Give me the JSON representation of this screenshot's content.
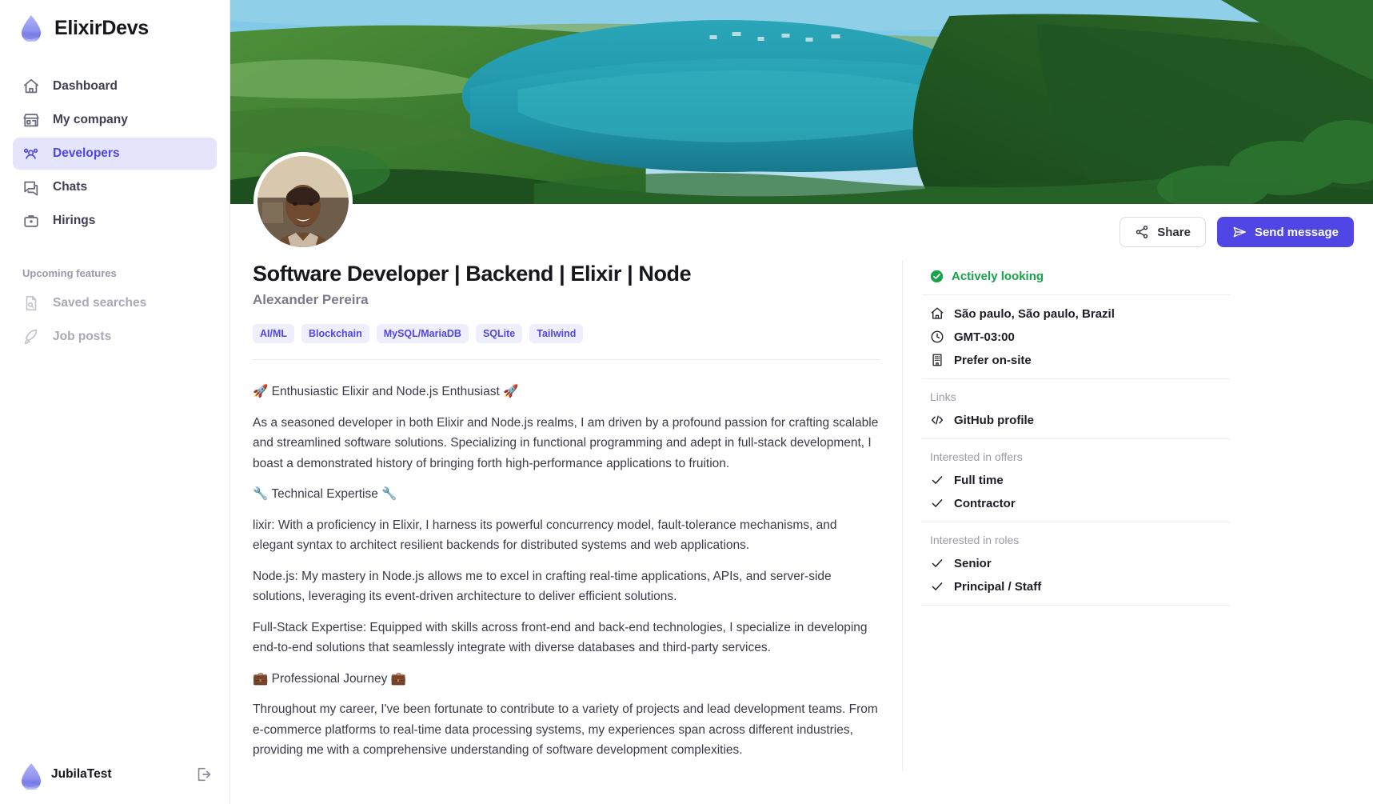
{
  "brand": {
    "name": "ElixirDevs",
    "logo_icon": "water-drop-icon"
  },
  "sidebar": {
    "items": [
      {
        "label": "Dashboard",
        "icon": "home-icon"
      },
      {
        "label": "My company",
        "icon": "store-icon"
      },
      {
        "label": "Developers",
        "icon": "users-group-icon"
      },
      {
        "label": "Chats",
        "icon": "chat-bubble-icon"
      },
      {
        "label": "Hirings",
        "icon": "briefcase-icon"
      }
    ],
    "section_label": "Upcoming features",
    "upcoming": [
      {
        "label": "Saved searches",
        "icon": "document-search-icon"
      },
      {
        "label": "Job posts",
        "icon": "rocket-icon"
      }
    ],
    "footer": {
      "user_name": "JubilaTest",
      "logout_icon": "logout-icon",
      "avatar_icon": "water-drop-icon"
    }
  },
  "toolbar": {
    "share_label": "Share",
    "share_icon": "share-icon",
    "send_message_label": "Send message",
    "send_message_icon": "paper-plane-icon",
    "primary_color": "#4f46e5"
  },
  "profile": {
    "job_title": "Software Developer | Backend | Elixir | Node",
    "person_name": "Alexander Pereira",
    "tags": [
      "AI/ML",
      "Blockchain",
      "MySQL/MariaDB",
      "SQLite",
      "Tailwind"
    ],
    "bio": [
      "🚀 Enthusiastic Elixir and Node.js Enthusiast 🚀",
      "As a seasoned developer in both Elixir and Node.js realms, I am driven by a profound passion for crafting scalable and streamlined software solutions. Specializing in functional programming and adept in full-stack development, I boast a demonstrated history of bringing forth high-performance applications to fruition.",
      "🔧 Technical Expertise 🔧",
      "lixir: With a proficiency in Elixir, I harness its powerful concurrency model, fault-tolerance mechanisms, and elegant syntax to architect resilient backends for distributed systems and web applications.",
      "Node.js: My mastery in Node.js allows me to excel in crafting real-time applications, APIs, and server-side solutions, leveraging its event-driven architecture to deliver efficient solutions.",
      "Full-Stack Expertise: Equipped with skills across front-end and back-end technologies, I specialize in developing end-to-end solutions that seamlessly integrate with diverse databases and third-party services.",
      "💼 Professional Journey 💼",
      "Throughout my career, I've been fortunate to contribute to a variety of projects and lead development teams. From e-commerce platforms to real-time data processing systems, my experiences span across different industries, providing me with a comprehensive understanding of software development complexities."
    ]
  },
  "details": {
    "status": {
      "text": "Actively looking",
      "icon": "check-circle-icon",
      "color": "#16a34a"
    },
    "info": [
      {
        "text": "São paulo, São paulo, Brazil",
        "icon": "home-icon"
      },
      {
        "text": "GMT-03:00",
        "icon": "clock-icon"
      },
      {
        "text": "Prefer on-site",
        "icon": "building-icon"
      }
    ],
    "links": {
      "title": "Links",
      "items": [
        {
          "text": "GitHub profile",
          "icon": "code-brackets-icon"
        }
      ]
    },
    "offers": {
      "title": "Interested in offers",
      "items": [
        {
          "text": "Full time",
          "icon": "check-icon"
        },
        {
          "text": "Contractor",
          "icon": "check-icon"
        }
      ]
    },
    "roles": {
      "title": "Interested in roles",
      "items": [
        {
          "text": "Senior",
          "icon": "check-icon"
        },
        {
          "text": "Principal / Staff",
          "icon": "check-icon"
        }
      ]
    }
  }
}
